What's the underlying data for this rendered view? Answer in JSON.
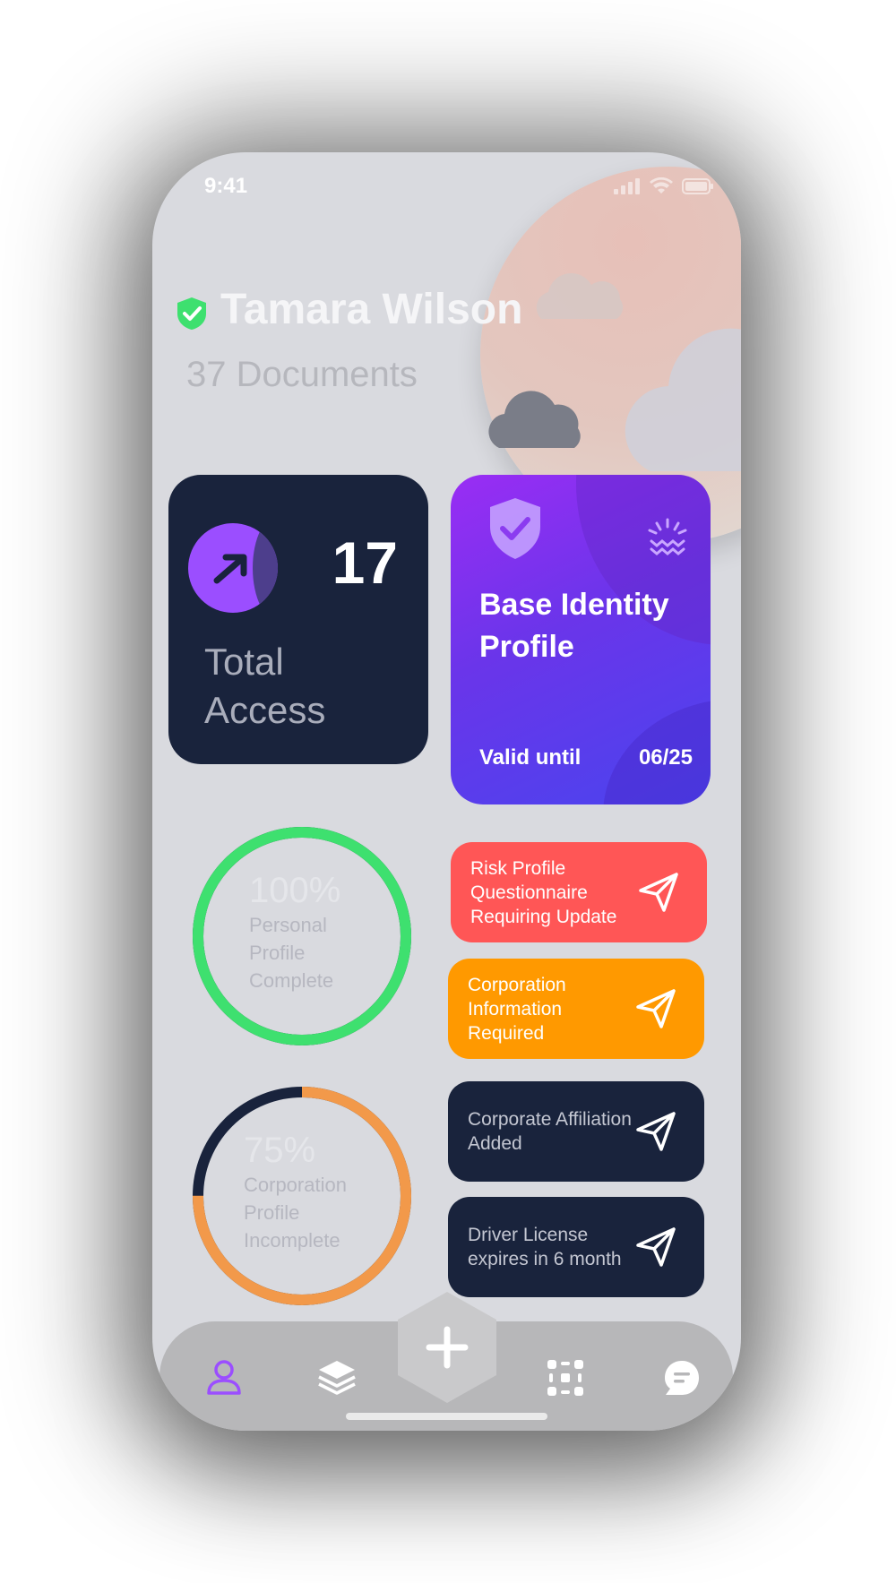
{
  "status_bar": {
    "time": "9:41"
  },
  "header": {
    "name": "Tamara Wilson",
    "documents": "37 Documents"
  },
  "access_card": {
    "value": "17",
    "label": "Total Access"
  },
  "identity_card": {
    "title": "Base Identity Profile",
    "valid_label": "Valid until",
    "valid_date": "06/25"
  },
  "progress": [
    {
      "percent": "100%",
      "label": "Personal Profile Complete",
      "fraction": 1.0,
      "color": "#3ee06f"
    },
    {
      "percent": "75%",
      "label": "Corporation Profile Incomplete",
      "fraction": 0.75,
      "color": "#f2994a"
    }
  ],
  "alerts": [
    {
      "text": "Risk Profile Questionnaire Requiring Update",
      "color": "#ff5656"
    },
    {
      "text": "Corporation Information Required",
      "color": "#ff9900"
    },
    {
      "text": "Corporate Affiliation Added",
      "color": "#19233c"
    },
    {
      "text": "Driver License expires in 6 month",
      "color": "#19233c"
    }
  ],
  "tabbar": {
    "items": [
      "profile-icon",
      "layers-icon",
      "scan-icon",
      "chat-icon"
    ],
    "active": "profile-icon",
    "fab_icon": "plus-icon"
  },
  "colors": {
    "ring_track": "#19233c",
    "accent": "#9b4eff",
    "verified": "#3ee06f"
  }
}
